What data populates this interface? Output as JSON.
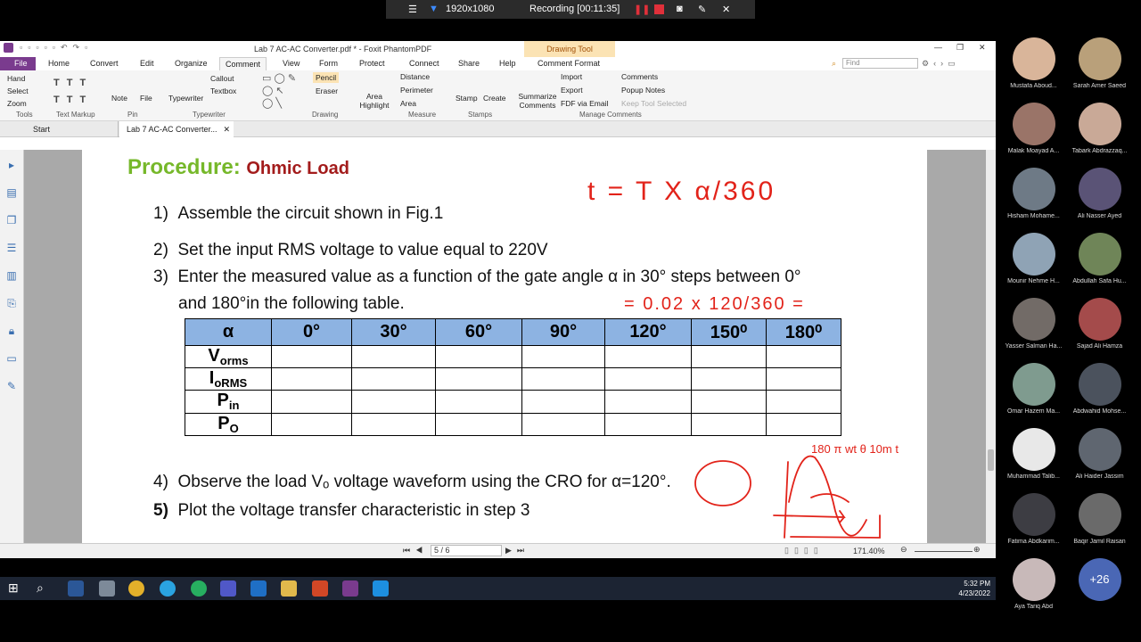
{
  "recording": {
    "resolution": "1920x1080",
    "label": "Recording [00:11:35]"
  },
  "app": {
    "title": "Lab 7 AC-AC Converter.pdf * - Foxit PhantomPDF",
    "context_tab": "Drawing Tool",
    "window": {
      "min": "—",
      "max": "❐",
      "close": "✕"
    },
    "menu": [
      "File",
      "Home",
      "Convert",
      "Edit",
      "Organize",
      "Comment",
      "View",
      "Form",
      "Protect",
      "Connect",
      "Share",
      "Help",
      "Comment Format"
    ],
    "search_placeholder": "Find"
  },
  "ribbon": {
    "tools": [
      "Hand",
      "Select",
      "Zoom"
    ],
    "text_markup_icons": [
      "T",
      "T",
      "T",
      "T",
      "T",
      "T"
    ],
    "pin": [
      "Note",
      "File"
    ],
    "typewriter": [
      "Typewriter"
    ],
    "callout": [
      "Callout",
      "Textbox"
    ],
    "drawing": [
      "Pencil",
      "Eraser"
    ],
    "area_highlight": "Area Highlight",
    "measure": [
      "Distance",
      "Perimeter",
      "Area"
    ],
    "stamps": [
      "Stamp",
      "Create"
    ],
    "summarize": "Summarize Comments",
    "manage": [
      "Import",
      "Export",
      "FDF via Email",
      "Comments",
      "Popup Notes",
      "Keep Tool Selected"
    ],
    "groups": [
      "Tools",
      "Text Markup",
      "Pin",
      "Typewriter",
      "Drawing",
      "Measure",
      "Stamps",
      "Manage Comments"
    ]
  },
  "doc_tabs": [
    "Start",
    "Lab 7 AC-AC Converter..."
  ],
  "page": {
    "heading": "Procedure:",
    "heading_sub": "Ohmic Load",
    "steps": [
      {
        "n": "1)",
        "text": "Assemble the circuit shown in Fig.1"
      },
      {
        "n": "2)",
        "text": "Set the input RMS voltage to value equal to 220V"
      },
      {
        "n": "3)",
        "text": "Enter the measured value as a function of the gate angle α in 30° steps between 0°"
      },
      {
        "n": "",
        "text": "and 180°in the following table."
      },
      {
        "n": "4)",
        "text": "Observe the load Vₒ voltage waveform using the CRO for α=120°."
      },
      {
        "n": "5)",
        "text": "Plot the voltage transfer characteristic in step 3"
      }
    ],
    "table_header": [
      "α",
      "0°",
      "30°",
      "60°",
      "90°",
      "120°",
      "150⁰",
      "180⁰"
    ],
    "table_rows": [
      {
        "main": "V",
        "sub": "orms"
      },
      {
        "main": "I",
        "sub": "oRMS"
      },
      {
        "main": "P",
        "sub": "in"
      },
      {
        "main": "P",
        "sub": "O"
      }
    ]
  },
  "annotations": {
    "formula": "t = T X α/360",
    "calc": "= 0.02 x 120/360 =",
    "wave": [
      "180",
      "π",
      "wt",
      "θ",
      "10m",
      "t"
    ]
  },
  "status": {
    "page": "5 / 6",
    "zoom": "171.40%"
  },
  "taskbar": {
    "time": "5:32 PM",
    "date": "4/23/2022"
  },
  "participants": [
    {
      "name": "Mustafa Aboud...",
      "color": "#d9b59a"
    },
    {
      "name": "Sarah Amer Saeed",
      "color": "#b9a07a"
    },
    {
      "name": "Malak Moayad A...",
      "color": "#9a7468"
    },
    {
      "name": "Tabark Abdrazzaq...",
      "color": "#c9a997"
    },
    {
      "name": "Hisham Mohame...",
      "color": "#6e7a86"
    },
    {
      "name": "Ali Nasser Ayed",
      "color": "#5a5376"
    },
    {
      "name": "Mounir Nehme H...",
      "color": "#8fa3b5"
    },
    {
      "name": "Abdullah Safa Hu...",
      "color": "#6f8558"
    },
    {
      "name": "Yasser Salman Ha...",
      "color": "#726b67"
    },
    {
      "name": "Sajad Ali Hamza",
      "color": "#a44b4b"
    },
    {
      "name": "Omar Hazem Ma...",
      "color": "#7f9b8f"
    },
    {
      "name": "Abdwahid Mohse...",
      "color": "#4b525d"
    },
    {
      "name": "Muhammad Talib...",
      "color": "#e8e8e8"
    },
    {
      "name": "Ali Haider Jassim",
      "color": "#5f6670"
    },
    {
      "name": "Fatima Abdkarim...",
      "color": "#3d3d43"
    },
    {
      "name": "Baqir Jamil Raisan",
      "color": "#6a6a6a"
    },
    {
      "name": "Aya Tariq Abd",
      "color": "#c8b9b9"
    }
  ],
  "more_participants": "+26"
}
